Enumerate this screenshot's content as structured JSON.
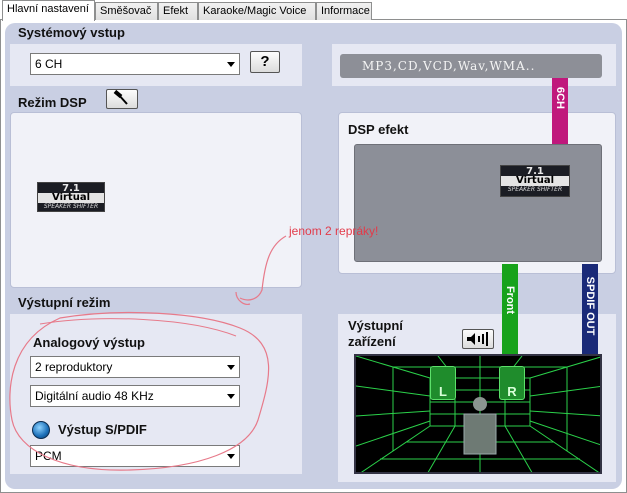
{
  "tabs": [
    {
      "label": "Hlavní nastavení",
      "active": true
    },
    {
      "label": "Směšovač",
      "active": false
    },
    {
      "label": "Efekt",
      "active": false
    },
    {
      "label": "Karaoke/Magic Voice",
      "active": false
    },
    {
      "label": "Informace",
      "active": false
    }
  ],
  "system_input": {
    "label": "Systémový vstup",
    "selected": "6 CH",
    "help_label": "?",
    "formats": "MP3,CD,VCD,Wav,WMA.."
  },
  "dsp_mode": {
    "label": "Režim DSP",
    "tool_icon": "hammer-icon"
  },
  "dsp_effect": {
    "label": "DSP efekt"
  },
  "virtual_logo": {
    "number": "7.1",
    "word": "Virtual",
    "sub": "SPEAKER SHIFTER"
  },
  "signal_labels": {
    "six_ch": "6CH",
    "front": "Front",
    "spdif_out": "SPDIF OUT"
  },
  "output_mode": {
    "label": "Výstupní režim",
    "analog_label": "Analogový výstup",
    "speakers_selected": "2 reproduktory",
    "sample_rate_selected": "Digitální audio 48 KHz",
    "spdif_label": "Výstup S/PDIF",
    "spdif_selected": "PCM"
  },
  "output_device": {
    "label_line1": "Výstupní",
    "label_line2": "zařízení",
    "speaker_left": "L",
    "speaker_right": "R"
  },
  "annotation": "jenom 2 repráky!",
  "colors": {
    "panel": "#c9cfe3",
    "six_ch_bar": "#c0187c",
    "front_bar": "#17a21b",
    "spdif_bar": "#1a2a78",
    "annotation": "#e23b4a",
    "grid": "#2bd14a"
  }
}
